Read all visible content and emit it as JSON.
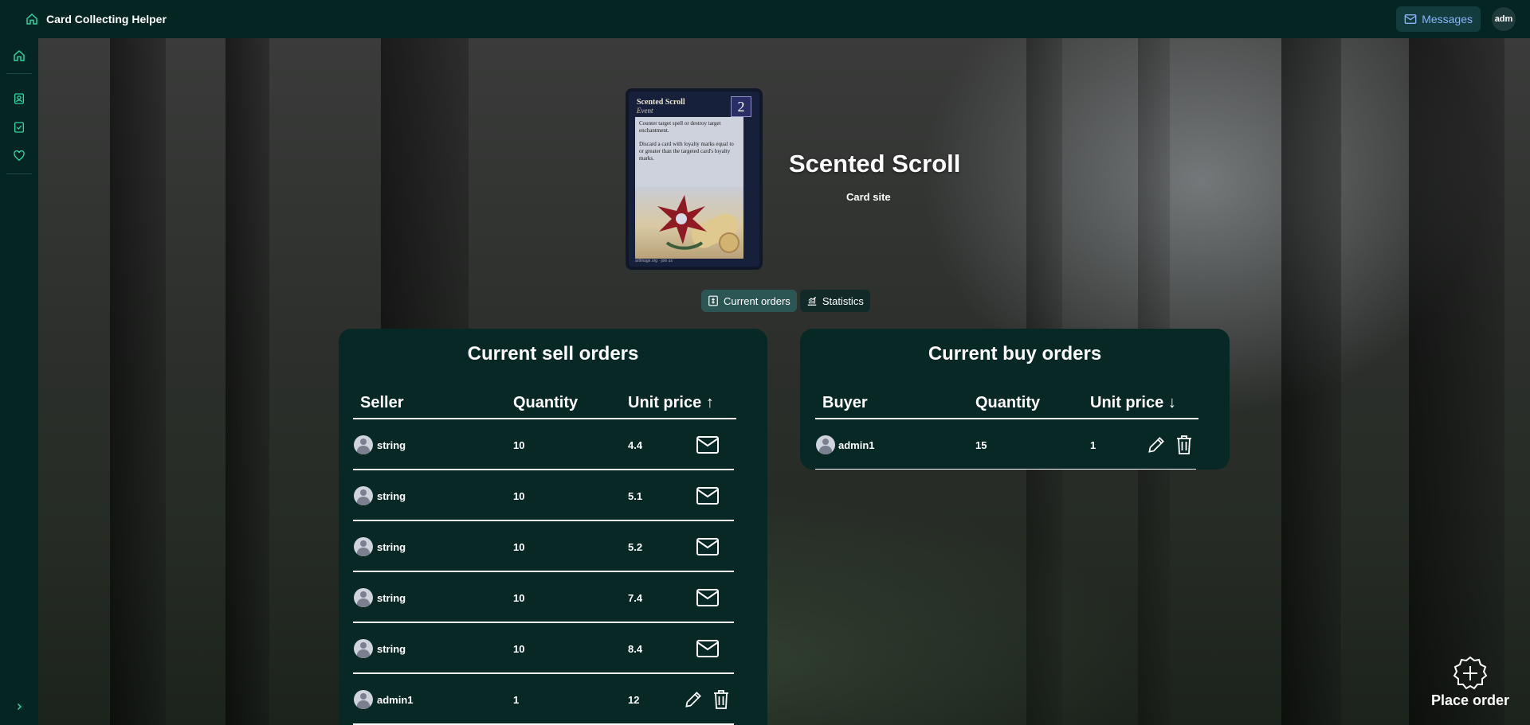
{
  "app": {
    "title": "Card Collecting Helper"
  },
  "topbar": {
    "messages_label": "Messages",
    "user_initials": "adm"
  },
  "card": {
    "name": "Scented Scroll",
    "link_label": "Card site",
    "image": {
      "title": "Scented Scroll",
      "type": "Event",
      "cost": "2",
      "rules_1": "Counter target spell or destroy target enchantment.",
      "rules_2": "Discard a card with loyalty marks equal to or greater than the targeted card's loyalty marks.",
      "footer": "artimage.org · join us"
    }
  },
  "tabs": [
    {
      "label": "Current orders",
      "icon": "orders-icon",
      "active": true
    },
    {
      "label": "Statistics",
      "icon": "chart-icon",
      "active": false
    }
  ],
  "sell": {
    "title": "Current sell orders",
    "columns": {
      "user": "Seller",
      "quantity": "Quantity",
      "price": "Unit price",
      "sort": "↑"
    },
    "rows": [
      {
        "user": "string",
        "quantity": "10",
        "price": "4.4",
        "actions": "message"
      },
      {
        "user": "string",
        "quantity": "10",
        "price": "5.1",
        "actions": "message"
      },
      {
        "user": "string",
        "quantity": "10",
        "price": "5.2",
        "actions": "message"
      },
      {
        "user": "string",
        "quantity": "10",
        "price": "7.4",
        "actions": "message"
      },
      {
        "user": "string",
        "quantity": "10",
        "price": "8.4",
        "actions": "message"
      },
      {
        "user": "admin1",
        "quantity": "1",
        "price": "12",
        "actions": "edit-delete"
      }
    ]
  },
  "buy": {
    "title": "Current buy orders",
    "columns": {
      "user": "Buyer",
      "quantity": "Quantity",
      "price": "Unit price",
      "sort": "↓"
    },
    "rows": [
      {
        "user": "admin1",
        "quantity": "15",
        "price": "1",
        "actions": "edit-delete"
      }
    ]
  },
  "place_order": {
    "label": "Place order"
  },
  "colors": {
    "accent": "#2dd4a8",
    "panel": "#082825",
    "bar": "#052522",
    "link": "#8ab4f8"
  }
}
